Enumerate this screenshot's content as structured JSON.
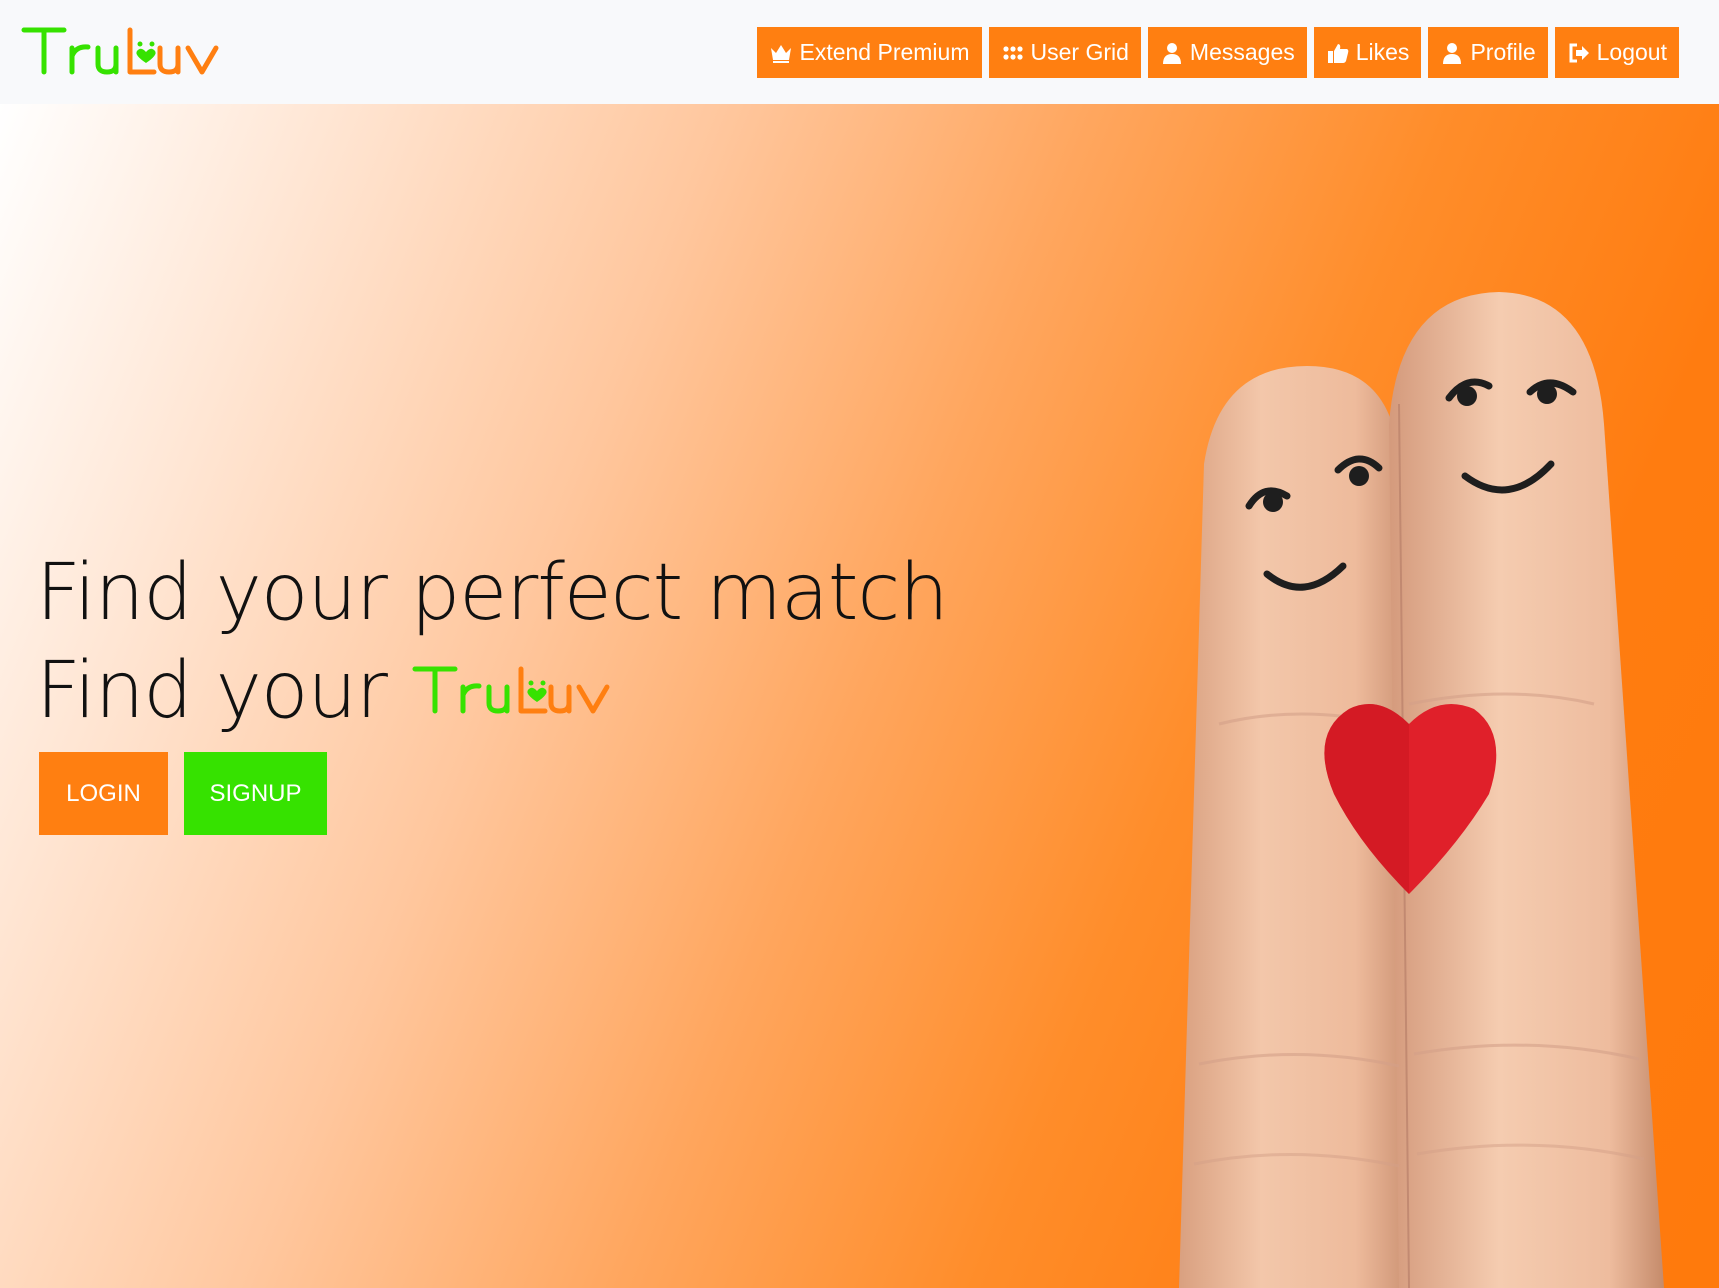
{
  "brand": {
    "logo_text": "TruLuv",
    "logo_part1": "Tru",
    "logo_part2": "Luv",
    "green": "#36e200",
    "orange": "#ff7f11"
  },
  "nav": {
    "items": [
      {
        "label": "Extend Premium",
        "icon": "crown-icon"
      },
      {
        "label": "User Grid",
        "icon": "grid-icon"
      },
      {
        "label": "Messages",
        "icon": "user-icon"
      },
      {
        "label": "Likes",
        "icon": "thumbs-up-icon"
      },
      {
        "label": "Profile",
        "icon": "user-icon"
      },
      {
        "label": "Logout",
        "icon": "sign-out-icon"
      }
    ]
  },
  "hero": {
    "line1": "Find your perfect match",
    "line2": "Find your",
    "image": "two-fingers-with-smiley-faces-and-red-heart",
    "background_colors": [
      "#ffffff",
      "#ff7a0c"
    ]
  },
  "actions": {
    "login_label": "LOGIN",
    "signup_label": "SIGNUP"
  }
}
